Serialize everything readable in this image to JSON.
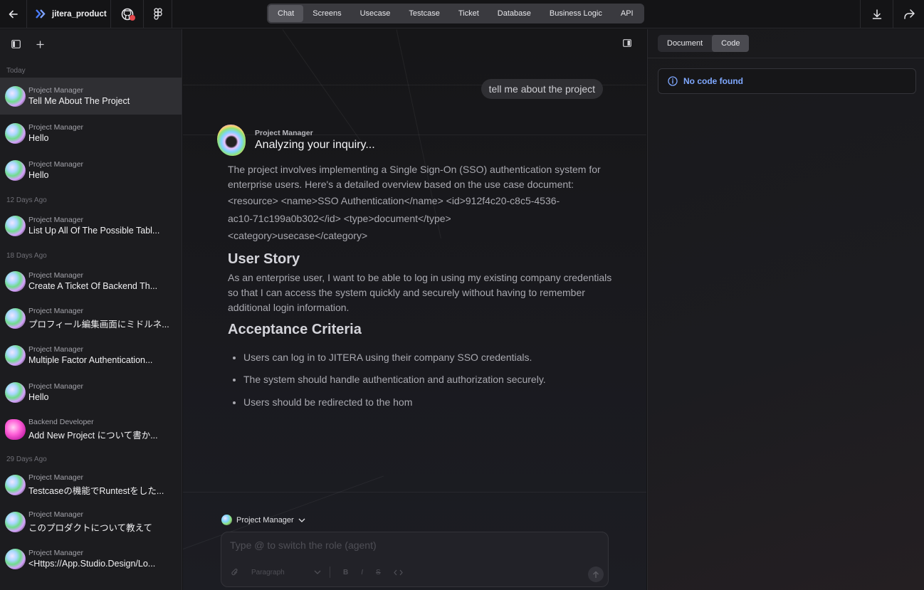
{
  "header": {
    "project_name": "jitera_product",
    "tabs": [
      "Chat",
      "Screens",
      "Usecase",
      "Testcase",
      "Ticket",
      "Database",
      "Business Logic",
      "API"
    ],
    "active_tab": "Chat"
  },
  "sidebar": {
    "groups": [
      {
        "label": "Today",
        "items": [
          {
            "role": "Project Manager",
            "title": "Tell Me About The Project",
            "active": true
          },
          {
            "role": "Project Manager",
            "title": "Hello"
          },
          {
            "role": "Project Manager",
            "title": "Hello"
          }
        ]
      },
      {
        "label": "12 Days Ago",
        "items": [
          {
            "role": "Project Manager",
            "title": "List Up All Of The Possible Tabl..."
          }
        ]
      },
      {
        "label": "18 Days Ago",
        "items": [
          {
            "role": "Project Manager",
            "title": "Create A Ticket Of Backend Th..."
          },
          {
            "role": "Project Manager",
            "title": "プロフィール編集画面にミドルネ..."
          },
          {
            "role": "Project Manager",
            "title": "Multiple Factor Authentication..."
          },
          {
            "role": "Project Manager",
            "title": "Hello"
          },
          {
            "role": "Backend Developer",
            "title": "Add New Project について書か...",
            "avatar": "pink"
          }
        ]
      },
      {
        "label": "29 Days Ago",
        "items": [
          {
            "role": "Project Manager",
            "title": "Testcaseの機能でRuntestをした..."
          },
          {
            "role": "Project Manager",
            "title": "このプロダクトについて教えて"
          },
          {
            "role": "Project Manager",
            "title": "<Https://App.Studio.Design/Lo..."
          }
        ]
      }
    ]
  },
  "chat": {
    "user_message": "tell me about the project",
    "agent_role": "Project Manager",
    "agent_status": "Analyzing your inquiry...",
    "intro": "The project involves implementing a Single Sign-On (SSO) authentication system for enterprise users. Here's a detailed overview based on the use case document:",
    "resource_lines": [
      "<resource> <name>SSO Authentication</name> <id>912f4c20-c8c5-4536-",
      "ac10-71c199a0b302</id> <type>document</type>",
      "<category>usecase</category>"
    ],
    "h_story": "User Story",
    "story": "As an enterprise user, I want to be able to log in using my existing company credentials so that I can access the system quickly and securely without having to remember additional login information.",
    "h_criteria": "Acceptance Criteria",
    "criteria": [
      "Users can log in to JITERA using their company SSO credentials.",
      "The system should handle authentication and authorization securely.",
      "Users should be redirected to the hom"
    ]
  },
  "composer": {
    "role": "Project Manager",
    "placeholder": "Type @ to switch the role (agent)",
    "format": "Paragraph",
    "bold": "B",
    "italic": "I",
    "strike": "S"
  },
  "right_panel": {
    "tabs": [
      "Document",
      "Code"
    ],
    "active_tab": "Code",
    "notice": "No code found"
  },
  "colors": {
    "accent": "#7fa8ff",
    "active_tab": "#55555b",
    "badge": "#e5484d"
  },
  "icons": [
    "arrow-left-icon",
    "jitera-logo-icon",
    "github-icon",
    "figma-icon",
    "download-icon",
    "share-icon",
    "sidebar-toggle-icon",
    "plus-icon",
    "panel-toggle-icon",
    "info-icon",
    "chevron-down-icon",
    "paperclip-icon",
    "code-icon",
    "send-icon"
  ]
}
